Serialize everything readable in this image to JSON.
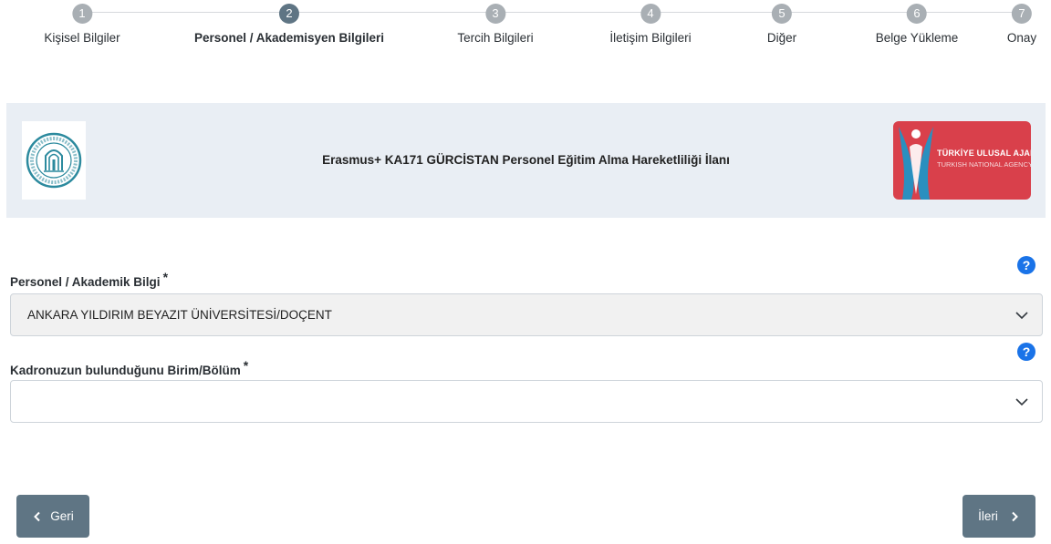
{
  "stepper": {
    "steps": [
      {
        "number": "1",
        "label": "Kişisel Bilgiler"
      },
      {
        "number": "2",
        "label": "Personel / Akademisyen Bilgileri"
      },
      {
        "number": "3",
        "label": "Tercih Bilgileri"
      },
      {
        "number": "4",
        "label": "İletişim Bilgileri"
      },
      {
        "number": "5",
        "label": "Diğer"
      },
      {
        "number": "6",
        "label": "Belge Yükleme"
      },
      {
        "number": "7",
        "label": "Onay"
      }
    ],
    "active_step": 2
  },
  "banner": {
    "title": "Erasmus+ KA171 GÜRCİSTAN Personel Eğitim Alma Hareketliliği İlanı",
    "agency_name": "TÜRKİYE ULUSAL AJANSI",
    "agency_subname": "TURKISH NATIONAL AGENCY"
  },
  "form": {
    "academic_info": {
      "label": "Personel / Akademik Bilgi",
      "required_mark": "*",
      "value": "ANKARA YILDIRIM BEYAZIT ÜNİVERSİTESİ/DOÇENT"
    },
    "unit_department": {
      "label": "Kadronuzun bulunduğunu Birim/Bölüm",
      "required_mark": "*",
      "value": ""
    },
    "help_symbol": "?"
  },
  "buttons": {
    "back_label": "Geri",
    "next_label": "İleri"
  },
  "colors": {
    "step_active": "#5f7584",
    "step_inactive": "#a9afb4",
    "banner_bg": "#e9eef4",
    "help_blue": "#1a73e8",
    "button_bg": "#5f7584",
    "agency_red": "#d9404b"
  }
}
